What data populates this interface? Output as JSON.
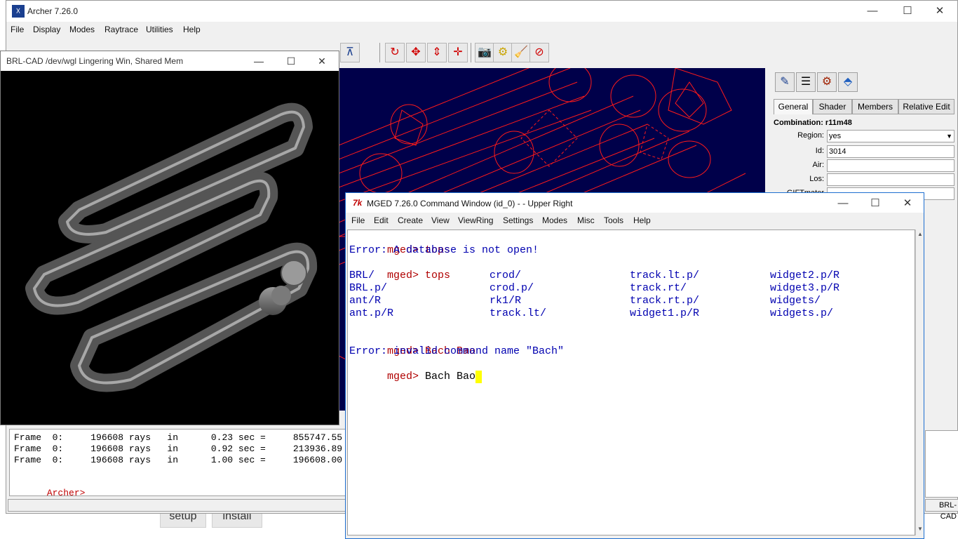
{
  "background": {
    "setup_label": "setup",
    "install_label": "install"
  },
  "archer": {
    "title": "Archer 7.26.0",
    "logo_icon": "archer-logo-icon",
    "menu": [
      "File",
      "Display",
      "Modes",
      "Raytrace",
      "Utilities",
      "Help"
    ],
    "window_controls": {
      "minimize": "—",
      "maximize": "☐",
      "close": "✕"
    },
    "console_lines": [
      "Frame  0:     196608 rays   in      0.23 sec =     855747.55",
      "Frame  0:     196608 rays   in      0.92 sec =     213936.89",
      "Frame  0:     196608 rays   in      1.00 sec =     196608.00"
    ],
    "console_prompt": "Archer>",
    "status_right": "BRL-CAD"
  },
  "side_panel": {
    "tabs": [
      "General",
      "Shader",
      "Members",
      "Relative Edit"
    ],
    "active_tab": "General",
    "combination": "Combination: r11m48",
    "fields": [
      {
        "label": "Region:",
        "value": "yes",
        "type": "select"
      },
      {
        "label": "Id:",
        "value": "3014",
        "type": "text"
      },
      {
        "label": "Air:",
        "value": "",
        "type": "text"
      },
      {
        "label": "Los:",
        "value": "",
        "type": "text"
      },
      {
        "label": "GIFTmater",
        "value": "",
        "type": "text"
      }
    ]
  },
  "brl_window": {
    "title": "BRL-CAD /dev/wgl Lingering Win, Shared Mem",
    "controls": {
      "minimize": "—",
      "maximize": "☐",
      "close": "✕"
    }
  },
  "mged": {
    "title": "MGED 7.26.0 Command Window (id_0) -  - Upper Right",
    "icon": "7k",
    "menu": [
      "File",
      "Edit",
      "Create",
      "View",
      "ViewRing",
      "Settings",
      "Modes",
      "Misc",
      "Tools",
      "Help"
    ],
    "controls": {
      "minimize": "—",
      "maximize": "☐",
      "close": "✕"
    },
    "prompt": "mged>",
    "cmd1": "tops",
    "err1": "Error: A database is not open!",
    "cmd2": "tops",
    "tops_rows": [
      [
        "BRL/",
        "crod/",
        "track.lt.p/",
        "widget2.p/R"
      ],
      [
        "BRL.p/",
        "crod.p/",
        "track.rt/",
        "widget3.p/R"
      ],
      [
        "ant/R",
        "rk1/R",
        "track.rt.p/",
        "widgets/"
      ],
      [
        "ant.p/R",
        "track.lt/",
        "widget1.p/R",
        "widgets.p/"
      ]
    ],
    "cmd3": "Bach Bao",
    "err3": "Error: invalid command name \"Bach\"",
    "cmd4": "Bach Bao"
  },
  "colors": {
    "geometry_bg": "#00004a",
    "wireframe": "#ff0000",
    "prompt": "#b00000",
    "output": "#0000b0",
    "cursor": "#ffff00"
  }
}
